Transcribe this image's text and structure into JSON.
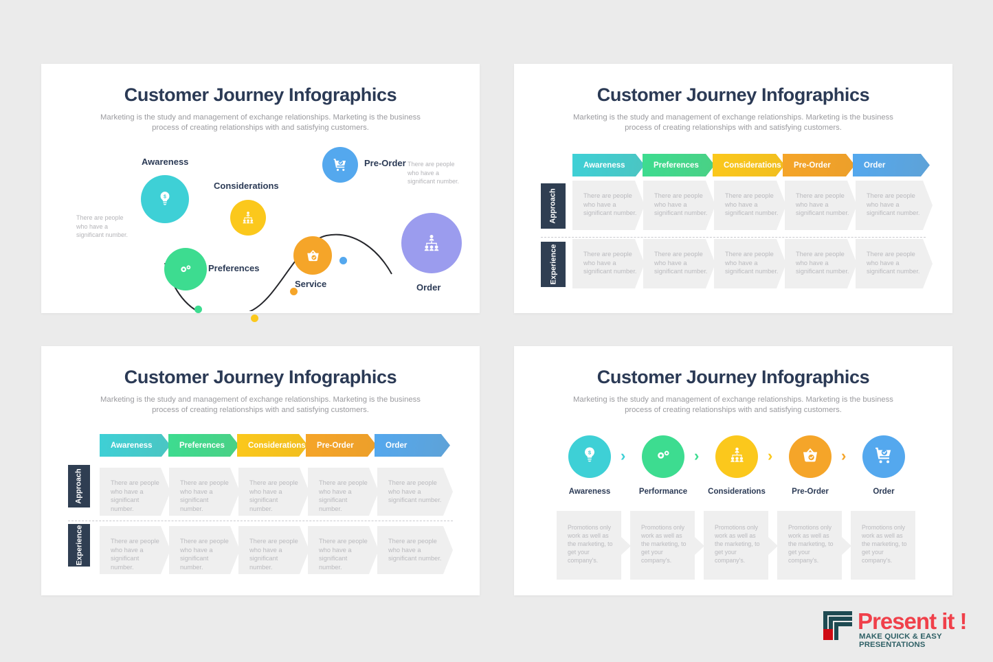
{
  "shared": {
    "title": "Customer Journey Infographics",
    "subtitle": "Marketing is the study and management of exchange relationships. Marketing is the business process of creating relationships with and satisfying customers.",
    "body_text": "There are people who have a significant number.",
    "promo_text": "Promotions only work as well as the marketing, to get your company's.",
    "row_labels": [
      "Approach",
      "Experience"
    ],
    "colors": {
      "teal": "#3ed0d6",
      "green": "#3ddc90",
      "yellow": "#fbc81c",
      "orange": "#f5a529",
      "blue": "#54a8ee",
      "purple": "#9b9cee",
      "navy": "#2f3e52",
      "gray_fill": "#efefef",
      "muted_text": "#b9b9bd",
      "logo_red": "#f0404a",
      "logo_teal": "#2f6066"
    }
  },
  "panel1": {
    "nodes": [
      {
        "label": "Awareness",
        "icon": "lightbulb-dollar-icon",
        "color": "#3ed0d6"
      },
      {
        "label": "Preferences",
        "icon": "gears-icon",
        "color": "#3ddc90"
      },
      {
        "label": "Considerations",
        "icon": "org-chart-icon",
        "color": "#fbc81c"
      },
      {
        "label": "Service",
        "icon": "basket-check-icon",
        "color": "#f5a529"
      },
      {
        "label": "Pre-Order",
        "icon": "cart-check-icon",
        "color": "#54a8ee"
      },
      {
        "label": "Order",
        "icon": "org-chart-icon",
        "color": "#9b9cee"
      }
    ],
    "notes": [
      "There are people who have a significant number.",
      "There are people who have a significant number."
    ],
    "curve_dots": [
      "#3ddc90",
      "#fbc81c",
      "#f5a529",
      "#54a8ee"
    ]
  },
  "panel2": {
    "stages": [
      {
        "label": "Awareness",
        "color": "#3ed0d6"
      },
      {
        "label": "Preferences",
        "color": "#3ddc90"
      },
      {
        "label": "Considerations",
        "color": "#fbc81c"
      },
      {
        "label": "Pre-Order",
        "color": "#f5a529"
      },
      {
        "label": "Order",
        "color": "#54a8ee"
      }
    ],
    "rows": [
      {
        "label": "Approach",
        "cells": [
          "There are people who have a significant number.",
          "There are people who have a significant number.",
          "There are people who have a significant number.",
          "There are people who have a significant number.",
          "There are people who have a significant number."
        ]
      },
      {
        "label": "Experience",
        "cells": [
          "There are people who have a significant number.",
          "There are people who have a significant number.",
          "There are people who have a significant number.",
          "There are people who have a significant number.",
          "There are people who have a significant number."
        ]
      }
    ]
  },
  "panel3": {
    "stages": [
      {
        "label": "Awareness",
        "color": "#3ed0d6"
      },
      {
        "label": "Preferences",
        "color": "#3ddc90"
      },
      {
        "label": "Considerations",
        "color": "#fbc81c"
      },
      {
        "label": "Pre-Order",
        "color": "#f5a529"
      },
      {
        "label": "Order",
        "color": "#54a8ee"
      }
    ],
    "rows": [
      {
        "label": "Approach",
        "cells": [
          "There are people who have a significant number.",
          "There are people who have a significant number.",
          "There are people who have a significant number.",
          "There are people who have a significant number.",
          "There are people who have a significant number."
        ]
      },
      {
        "label": "Experience",
        "cells": [
          "There are people who have a significant number.",
          "There are people who have a significant number.",
          "There are people who have a significant number.",
          "There are people who have a significant number.",
          "There are people who have a significant number."
        ]
      }
    ]
  },
  "panel4": {
    "steps": [
      {
        "label": "Awareness",
        "icon": "lightbulb-dollar-icon",
        "color": "#3ed0d6",
        "text": "Promotions only work as well as the marketing, to get your company's."
      },
      {
        "label": "Performance",
        "icon": "gears-icon",
        "color": "#3ddc90",
        "text": "Promotions only work as well as the marketing, to get your company's."
      },
      {
        "label": "Considerations",
        "icon": "org-chart-icon",
        "color": "#fbc81c",
        "text": "Promotions only work as well as the marketing, to get your company's."
      },
      {
        "label": "Pre-Order",
        "icon": "basket-check-icon",
        "color": "#f5a529",
        "text": "Promotions only work as well as the marketing, to get your company's."
      },
      {
        "label": "Order",
        "icon": "cart-check-icon",
        "color": "#54a8ee",
        "text": "Promotions only work as well as the marketing, to get your company's."
      }
    ],
    "arrow_glyph": "›"
  },
  "logo": {
    "name": "Present it !",
    "tagline": "MAKE QUICK & EASY PRESENTATIONS"
  }
}
